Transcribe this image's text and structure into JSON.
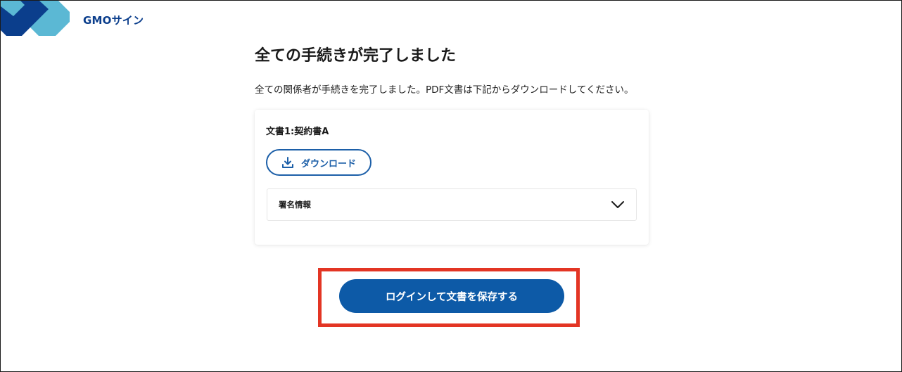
{
  "brand": {
    "name": "GMOサイン",
    "colors": {
      "primary": "#0d5aa7",
      "outline": "#1c5fa8",
      "highlight": "#e33524",
      "logo_light": "#5bb8d4",
      "logo_dark": "#0b3e8c"
    }
  },
  "main": {
    "title": "全ての手続きが完了しました",
    "description": "全ての関係者が手続きを完了しました。PDF文書は下記からダウンロードしてください。"
  },
  "document_card": {
    "document_name": "文書1:契約書A",
    "download_label": "ダウンロード",
    "download_icon": "download-icon",
    "accordion_label": "署名情報",
    "accordion_icon": "chevron-down-icon",
    "accordion_expanded": false
  },
  "cta": {
    "label": "ログインして文書を保存する",
    "highlighted": true
  }
}
